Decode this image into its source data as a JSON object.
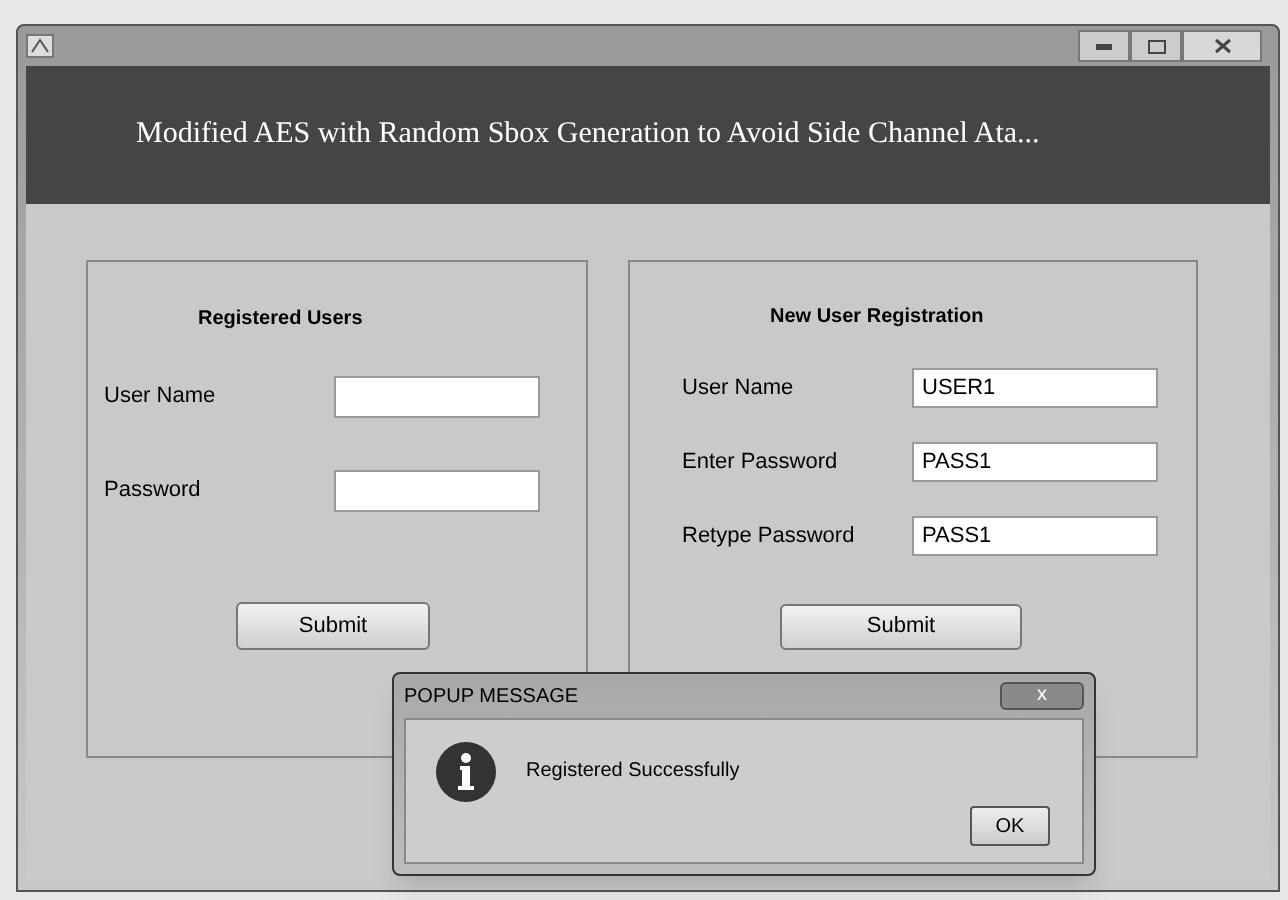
{
  "window": {
    "title": "Modified AES with Random Sbox Generation to Avoid Side Channel Ata..."
  },
  "registered_users": {
    "heading": "Registered Users",
    "fields": [
      {
        "label": "User Name"
      },
      {
        "label": "Password"
      }
    ],
    "submit": "Submit"
  },
  "new_user_registration": {
    "heading": "New User Registration",
    "fields": [
      {
        "label": "User Name",
        "value": "USER1"
      },
      {
        "label": "Enter Password",
        "value": "PASS1"
      },
      {
        "label": "Retype Password",
        "value": "PASS1"
      }
    ],
    "submit": "Submit"
  },
  "popup": {
    "title": "POPUP MESSAGE",
    "close": "x",
    "message": "Registered Successfully",
    "ok": "OK"
  }
}
